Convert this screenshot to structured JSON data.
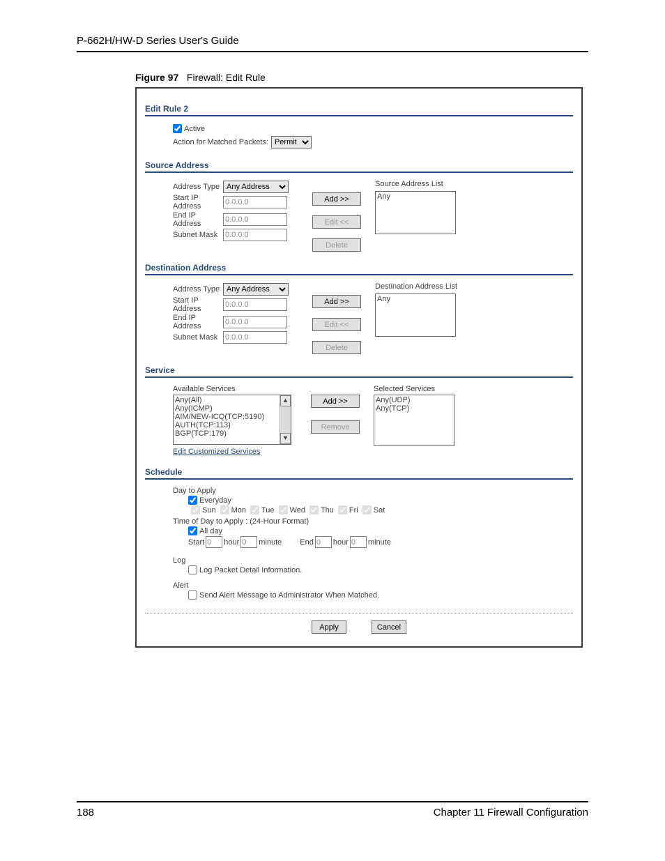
{
  "doc": {
    "header": "P-662H/HW-D Series User's Guide",
    "figure_num": "Figure 97",
    "figure_title": "Firewall: Edit Rule",
    "page_num": "188",
    "chapter": "Chapter 11 Firewall Configuration"
  },
  "rule": {
    "section_title": "Edit Rule 2",
    "active_label": "Active",
    "active_checked": true,
    "action_label": "Action for Matched Packets:",
    "action_value": "Permit"
  },
  "src": {
    "section_title": "Source Address",
    "addr_type_label": "Address Type",
    "addr_type_value": "Any Address",
    "start_ip_label": "Start IP Address",
    "end_ip_label": "End IP Address",
    "subnet_label": "Subnet Mask",
    "ip_value": "0.0.0.0",
    "list_title": "Source Address List",
    "list_items": [
      "Any"
    ],
    "btn_add": "Add >>",
    "btn_edit": "Edit <<",
    "btn_delete": "Delete"
  },
  "dst": {
    "section_title": "Destination Address",
    "addr_type_label": "Address Type",
    "addr_type_value": "Any Address",
    "start_ip_label": "Start IP Address",
    "end_ip_label": "End IP Address",
    "subnet_label": "Subnet Mask",
    "ip_value": "0.0.0.0",
    "list_title": "Destination Address List",
    "list_items": [
      "Any"
    ],
    "btn_add": "Add >>",
    "btn_edit": "Edit <<",
    "btn_delete": "Delete"
  },
  "svc": {
    "section_title": "Service",
    "avail_title": "Available Services",
    "avail_items": [
      "Any(All)",
      "Any(ICMP)",
      "AIM/NEW-ICQ(TCP:5190)",
      "AUTH(TCP:113)",
      "BGP(TCP:179)"
    ],
    "sel_title": "Selected Services",
    "sel_items": [
      "Any(UDP)",
      "Any(TCP)"
    ],
    "btn_add": "Add >>",
    "btn_remove": "Remove",
    "edit_link": "Edit Customized Services"
  },
  "sched": {
    "section_title": "Schedule",
    "day_label": "Day to Apply",
    "everyday_label": "Everyday",
    "everyday_checked": true,
    "days": [
      "Sun",
      "Mon",
      "Tue",
      "Wed",
      "Thu",
      "Fri",
      "Sat"
    ],
    "time_label": "Time of Day to Apply : (24-Hour Format)",
    "allday_label": "All day",
    "allday_checked": true,
    "start_label": "Start",
    "end_label": "End",
    "hour_label": "hour",
    "minute_label": "minute",
    "time_value": "0",
    "log_label": "Log",
    "log_detail_label": "Log Packet Detail Information.",
    "log_checked": false,
    "alert_label": "Alert",
    "alert_detail_label": "Send Alert Message to Administrator When Matched.",
    "alert_checked": false
  },
  "buttons": {
    "apply": "Apply",
    "cancel": "Cancel"
  }
}
